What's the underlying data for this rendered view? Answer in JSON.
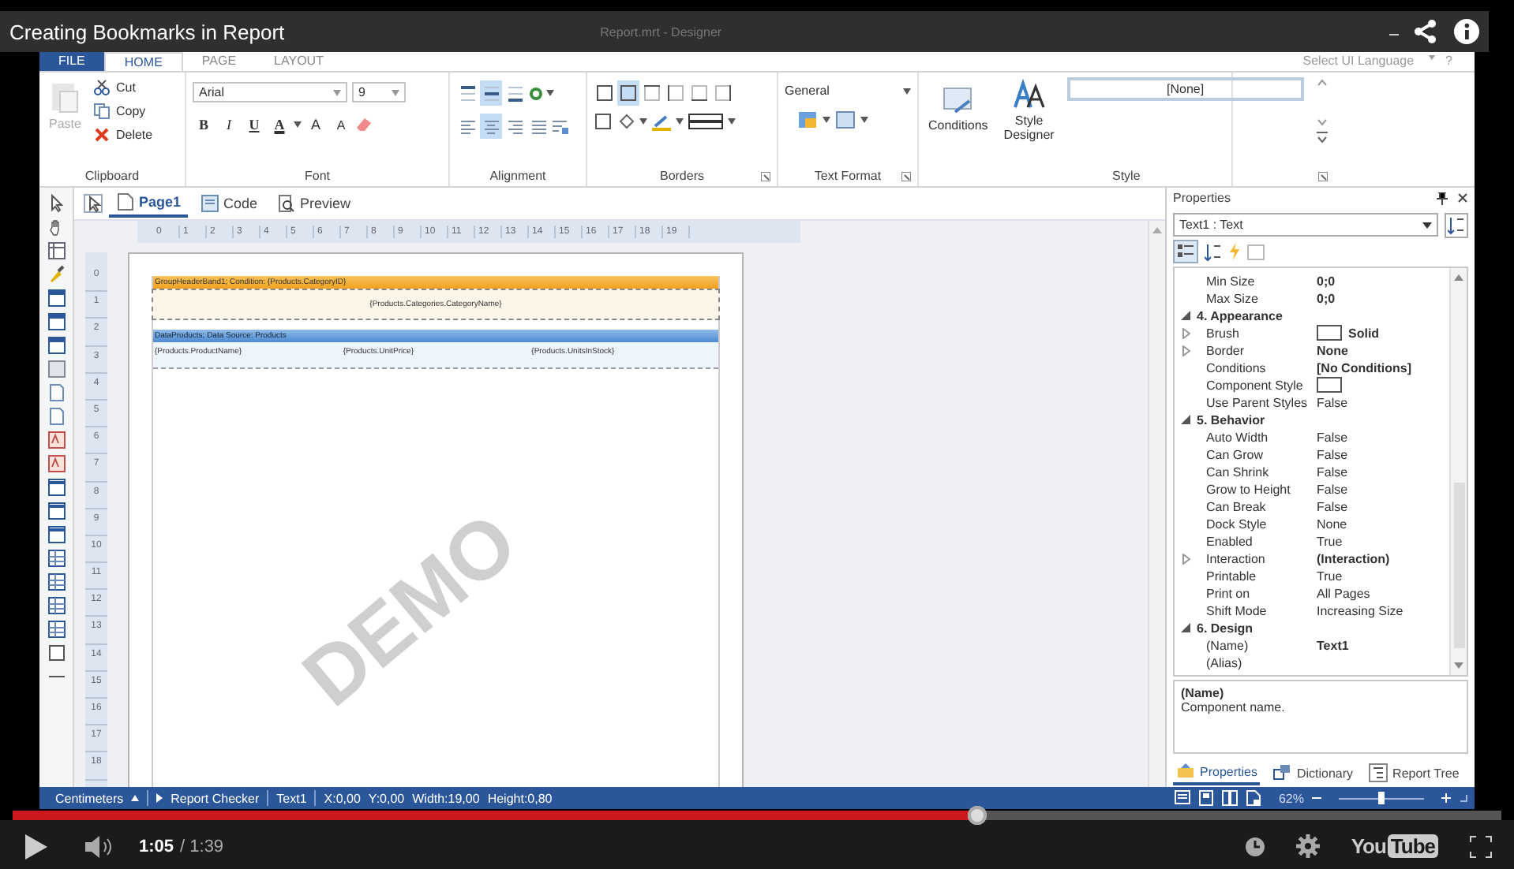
{
  "player": {
    "video_title": "Creating Bookmarks in Report",
    "progress": {
      "level": 0.648
    },
    "current_time": "1:05",
    "duration": "/ 1:39",
    "logo": {
      "you": "You",
      "tube": "Tube"
    }
  },
  "designer": {
    "window_title": "Report.mrt - Designer",
    "ribbon_tabs": [
      {
        "label": "FILE",
        "kind": "file",
        "selected": false
      },
      {
        "label": "HOME",
        "kind": "tab",
        "selected": true
      },
      {
        "label": "PAGE",
        "kind": "tab",
        "selected": false
      },
      {
        "label": "LAYOUT",
        "kind": "tab",
        "selected": false
      }
    ],
    "ui_language": "Select UI Language",
    "help": "?",
    "clipboard": {
      "label": "Clipboard",
      "paste": {
        "label": "Paste",
        "disabled": true
      },
      "cut": "Cut",
      "copy": "Copy",
      "delete": "Delete"
    },
    "font": {
      "label": "Font",
      "name": "Arial",
      "size": "9",
      "buttons": [
        {
          "label": "B",
          "kind": "bold"
        },
        {
          "label": "I",
          "kind": "italic"
        },
        {
          "label": "U",
          "kind": "underline"
        },
        {
          "label": "A",
          "kind": "color"
        },
        {
          "label": "A",
          "kind": "grow"
        },
        {
          "label": "A",
          "kind": "shrink"
        }
      ]
    },
    "alignment": {
      "label": "Alignment",
      "vertical": [
        {
          "selected": false
        },
        {
          "selected": true
        },
        {
          "selected": false
        }
      ],
      "horizontal": [
        {
          "selected": false
        },
        {
          "selected": true
        },
        {
          "selected": false
        },
        {
          "selected": false
        }
      ]
    },
    "borders": {
      "label": "Borders",
      "sides": [
        {
          "selected": false
        },
        {
          "selected": true
        },
        {
          "selected": false
        },
        {
          "selected": false
        },
        {
          "selected": false
        },
        {
          "selected": false
        }
      ]
    },
    "text_format": {
      "label": "Text Format",
      "format": "General"
    },
    "style": {
      "label": "Style",
      "conditions": "Conditions",
      "style_designer": "Style Designer",
      "current": "[None]"
    },
    "view_tabs": [
      {
        "label": "Page1",
        "selected": true
      },
      {
        "label": "Code",
        "selected": false
      },
      {
        "label": "Preview",
        "selected": false
      }
    ],
    "ruler": {
      "horizontal": [
        "0",
        "1",
        "2",
        "3",
        "4",
        "5",
        "6",
        "7",
        "8",
        "9",
        "10",
        "11",
        "12",
        "13",
        "14",
        "15",
        "16",
        "17",
        "18",
        "19"
      ],
      "vertical": [
        "0",
        "1",
        "2",
        "3",
        "4",
        "5",
        "6",
        "7",
        "8",
        "9",
        "10",
        "11",
        "12",
        "13",
        "14",
        "15",
        "16",
        "17",
        "18"
      ]
    },
    "report": {
      "group_header": "GroupHeaderBand1;  Condition: {Products.CategoryID}",
      "header_text": "{Products.Categories.CategoryName}",
      "data_band": "DataProducts; Data Source: Products",
      "cells": [
        "{Products.ProductName}",
        "{Products.UnitPrice}",
        "{Products.UnitsInStock}"
      ],
      "watermark": "DEMO"
    },
    "properties": {
      "title": "Properties",
      "component": "Text1 : Text",
      "rows": [
        {
          "kind": "property",
          "name": "Min Size",
          "value": "0;0",
          "bold": true
        },
        {
          "kind": "property",
          "name": "Max Size",
          "value": "0;0",
          "bold": true
        },
        {
          "kind": "category",
          "name": "4. Appearance",
          "expanded": true,
          "children": [
            {
              "kind": "property",
              "name": "Brush",
              "value": "Solid",
              "bold": true,
              "swatch": true,
              "expanded": false
            },
            {
              "kind": "property",
              "name": "Border",
              "value": "None",
              "bold": true,
              "expanded": false
            },
            {
              "kind": "property",
              "name": "Conditions",
              "value": "[No Conditions]",
              "bold": true
            },
            {
              "kind": "property",
              "name": "Component Style",
              "swatch": true
            },
            {
              "kind": "property",
              "name": "Use Parent Styles",
              "value": "False",
              "bold": false
            }
          ]
        },
        {
          "kind": "category",
          "name": "5. Behavior",
          "expanded": true,
          "children": [
            {
              "kind": "property",
              "name": "Auto Width",
              "value": "False",
              "bold": false
            },
            {
              "kind": "property",
              "name": "Can Grow",
              "value": "False",
              "bold": false
            },
            {
              "kind": "property",
              "name": "Can Shrink",
              "value": "False",
              "bold": false
            },
            {
              "kind": "property",
              "name": "Grow to Height",
              "value": "False",
              "bold": false
            },
            {
              "kind": "property",
              "name": "Can Break",
              "value": "False",
              "bold": false
            },
            {
              "kind": "property",
              "name": "Dock Style",
              "value": "None",
              "bold": false
            },
            {
              "kind": "property",
              "name": "Enabled",
              "value": "True",
              "bold": false
            },
            {
              "kind": "property",
              "name": "Interaction",
              "value": "(Interaction)",
              "bold": true,
              "expanded": false
            },
            {
              "kind": "property",
              "name": "Printable",
              "value": "True",
              "bold": false
            },
            {
              "kind": "property",
              "name": "Print on",
              "value": "All Pages",
              "bold": false
            },
            {
              "kind": "property",
              "name": "Shift Mode",
              "value": "Increasing Size",
              "bold": false
            }
          ]
        },
        {
          "kind": "category",
          "name": "6. Design",
          "expanded": true,
          "children": [
            {
              "kind": "property",
              "name": "(Name)",
              "value": "Text1",
              "bold": true
            },
            {
              "kind": "property",
              "name": "(Alias)"
            }
          ]
        }
      ],
      "description_title": "(Name)",
      "description": "Component name.",
      "tabs": [
        {
          "label": "Properties",
          "selected": true
        },
        {
          "label": "Dictionary",
          "selected": false
        },
        {
          "label": "Report Tree",
          "selected": false
        }
      ]
    },
    "status_bar": {
      "units": "Centimeters",
      "report_checker": "Report Checker",
      "component": "Text1",
      "x": "X:0,00",
      "y": "Y:0,00",
      "width": "Width:19,00",
      "height": "Height:0,80",
      "zoom": "62%",
      "zoom_slider": {
        "level": 0.5
      }
    }
  }
}
